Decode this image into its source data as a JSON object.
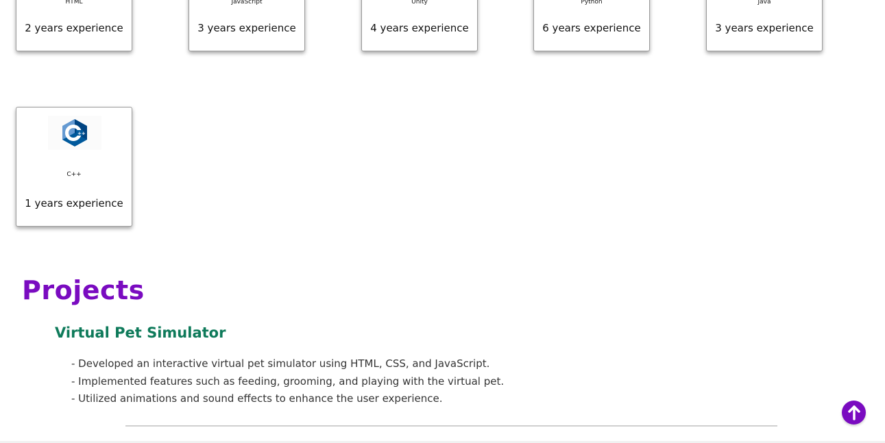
{
  "skills": [
    {
      "name": "HTML",
      "experience": "2 years experience"
    },
    {
      "name": "JavaScript",
      "experience": "3 years experience"
    },
    {
      "name": "Unity",
      "experience": "4 years experience"
    },
    {
      "name": "Python",
      "experience": "6 years experience"
    },
    {
      "name": "Java",
      "experience": "3 years experience"
    },
    {
      "name": "C++",
      "experience": "1 years experience",
      "icon": "cpp-logo-icon"
    }
  ],
  "projects": {
    "heading": "Projects",
    "items": [
      {
        "title": "Virtual Pet Simulator",
        "bullets": [
          "- Developed an interactive virtual pet simulator using HTML, CSS, and JavaScript.",
          "- Implemented features such as feeding, grooming, and playing with the virtual pet.",
          "- Utilized animations and sound effects to enhance the user experience."
        ]
      }
    ]
  },
  "scroll_top": {
    "icon": "arrow-up-icon"
  },
  "colors": {
    "accent_purple": "#7a0bc0",
    "project_green": "#0e7a5a",
    "cpp_blue": "#00599c"
  }
}
